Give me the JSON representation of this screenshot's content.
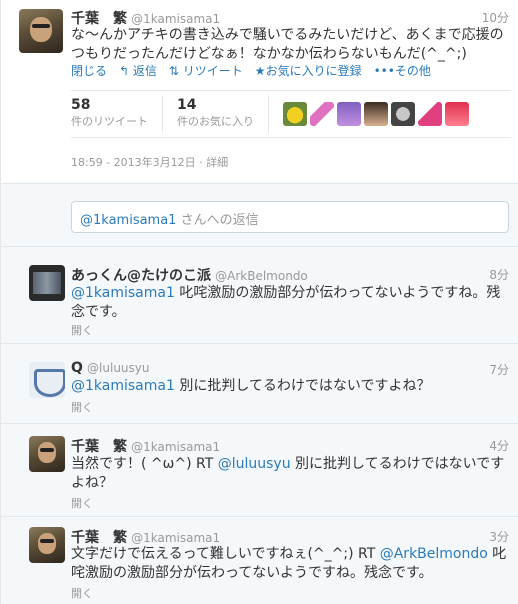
{
  "main_tweet": {
    "name": "千葉　繁",
    "handle": "@1kamisama1",
    "time": "10分",
    "text_line1": "な〜んかアチキの書き込みで騒いでるみたいだけど、あくまで応援の",
    "text_line2": "つもりだったんだけどなぁ！なかなか伝わらないもんだ(^_^;)",
    "actions": {
      "close": "閉じる",
      "reply": "返信",
      "retweet": "リツイート",
      "favorite": "お気に入りに登録",
      "more": "その他"
    },
    "retweet_count": "58",
    "retweet_label": "件のリツイート",
    "favorite_count": "14",
    "favorite_label": "件のお気に入り",
    "timestamp": "18:59 - 2013年3月12日",
    "details": "詳細"
  },
  "reply_box": {
    "mention": "@1kamisama1",
    "placeholder_suffix": " さんへの返信"
  },
  "replies": [
    {
      "name": "あっくん@たけのこ派",
      "handle": "@ArkBelmondo",
      "time": "8分",
      "mention": "@1kamisama1",
      "text": " 叱咤激励の激励部分が伝わってないようですね。残念です。",
      "open": "開く"
    },
    {
      "name": "Q",
      "handle": "@luluusyu",
      "time": "7分",
      "mention": "@1kamisama1",
      "text": " 別に批判してるわけではないですよね？",
      "open": "開く"
    },
    {
      "name": "千葉　繁",
      "handle": "@1kamisama1",
      "time": "4分",
      "text_before": "当然です！( ^ω^) RT ",
      "mention": "@luluusyu",
      "text_after": " 別に批判してるわけではないですよね？",
      "open": "開く"
    },
    {
      "name": "千葉　繁",
      "handle": "@1kamisama1",
      "time": "3分",
      "text_before": "文字だけで伝えるって難しいですねぇ(^_^;) RT ",
      "mention": "@ArkBelmondo",
      "text_after": " 叱咤激励の激励部分が伝わってないようですね。残念です。",
      "open": "開く"
    }
  ],
  "colors": {
    "link": "#2b7bb9",
    "muted": "#999999",
    "reply_bg": "#f5f8fa"
  }
}
